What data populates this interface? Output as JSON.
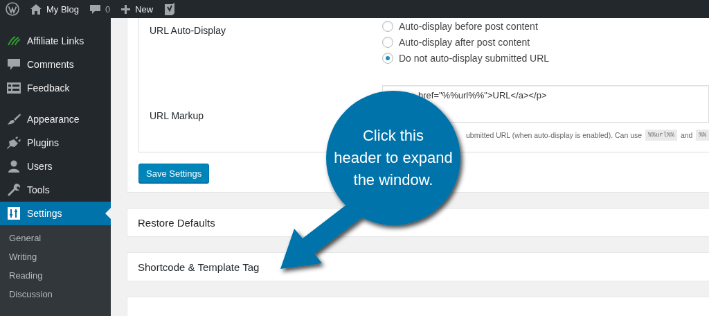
{
  "top_bar": {
    "site": "My Blog",
    "comments": "0",
    "new": "New"
  },
  "sidebar": {
    "items": [
      {
        "label": "Affiliate Links",
        "selected": false
      },
      {
        "label": "Comments",
        "selected": false
      },
      {
        "label": "Feedback",
        "selected": false
      },
      {
        "label": "Appearance",
        "selected": false
      },
      {
        "label": "Plugins",
        "selected": false
      },
      {
        "label": "Users",
        "selected": false
      },
      {
        "label": "Tools",
        "selected": false
      },
      {
        "label": "Settings",
        "selected": true
      }
    ],
    "submenu": [
      "General",
      "Writing",
      "Reading",
      "Discussion"
    ]
  },
  "settings": {
    "rows": [
      {
        "kind": "radios",
        "label": "URL Auto-Display",
        "options": [
          {
            "label": "Auto-display before post content",
            "selected": false
          },
          {
            "label": "Auto-display after post content",
            "selected": false
          },
          {
            "label": "Do not auto-display submitted URL",
            "selected": true
          }
        ]
      },
      {
        "kind": "textarea",
        "label": "URL Markup",
        "value": "href=\"%%url%%\">URL</a></p>",
        "description": [
          {
            "kind": "text",
            "text": "ubmitted URL (when auto-display is enabled). Can use"
          },
          {
            "kind": "code",
            "text": "%%url%%"
          },
          {
            "kind": "text",
            "text": "and"
          },
          {
            "kind": "code",
            "text": "%%"
          }
        ]
      }
    ],
    "save_button": "Save Settings"
  },
  "sections": [
    {
      "title": "Restore Defaults"
    },
    {
      "title": "Shortcode & Template Tag"
    }
  ],
  "next_section_panel": true,
  "callout": {
    "lines": [
      "Click this",
      "header to expand",
      "the window."
    ]
  }
}
